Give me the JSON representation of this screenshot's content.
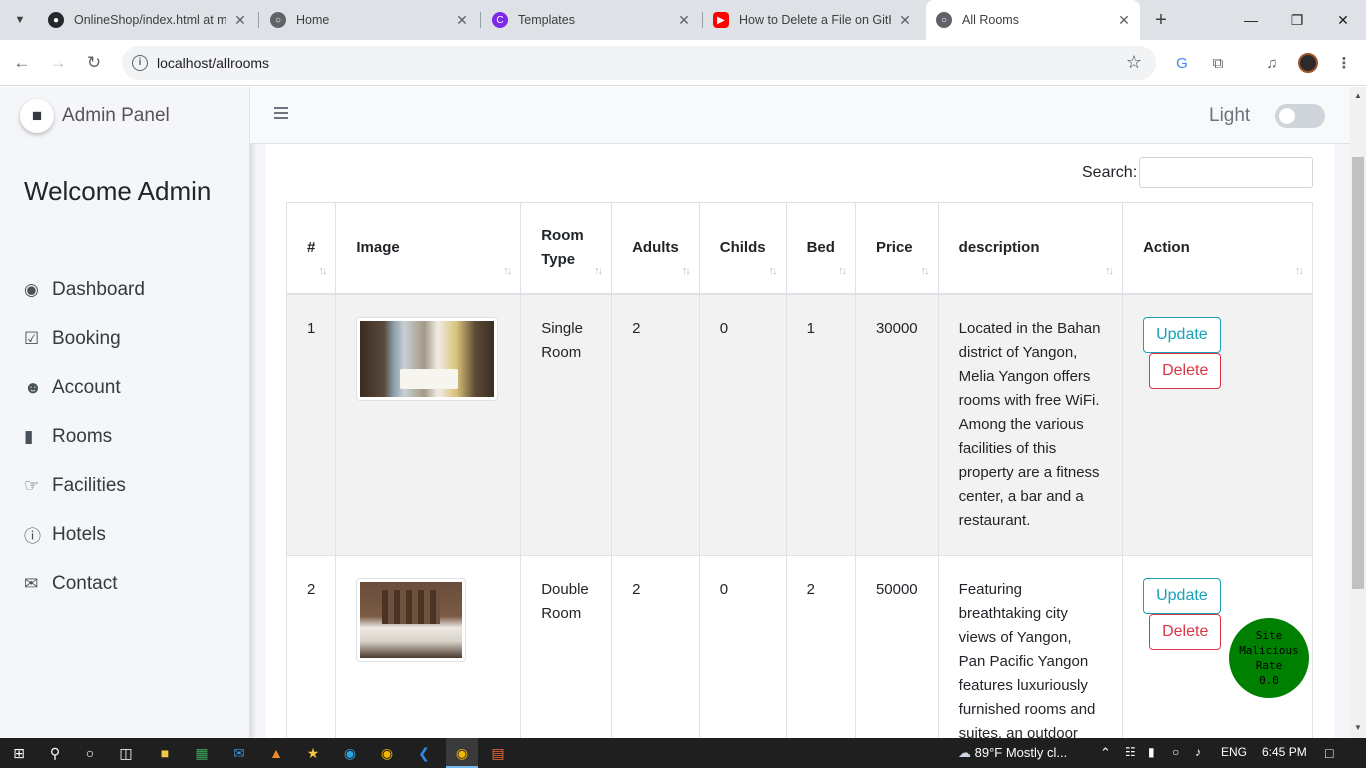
{
  "browser": {
    "tabs": [
      {
        "title": "OnlineShop/index.html at m",
        "icon": "github-icon"
      },
      {
        "title": "Home",
        "icon": "globe-icon"
      },
      {
        "title": "Templates",
        "icon": "canva-icon"
      },
      {
        "title": "How to Delete a File on GitH",
        "icon": "youtube-icon"
      },
      {
        "title": "All Rooms",
        "icon": "globe-icon",
        "active": true
      }
    ],
    "url": "localhost/allrooms"
  },
  "sidebar": {
    "brand": "Admin Panel",
    "welcome": "Welcome Admin",
    "items": [
      {
        "label": "Dashboard",
        "icon": "palette-icon"
      },
      {
        "label": "Booking",
        "icon": "calendar-check-icon"
      },
      {
        "label": "Account",
        "icon": "users-icon"
      },
      {
        "label": "Rooms",
        "icon": "door-icon"
      },
      {
        "label": "Facilities",
        "icon": "hand-holding-icon"
      },
      {
        "label": "Hotels",
        "icon": "info-icon"
      },
      {
        "label": "Contact",
        "icon": "envelope-icon"
      }
    ]
  },
  "topbar": {
    "theme_label": "Light",
    "theme_dark_enabled": false
  },
  "content": {
    "search_label": "Search:",
    "search_value": "",
    "columns": [
      "#",
      "Image",
      "Room Type",
      "Adults",
      "Childs",
      "Bed",
      "Price",
      "description",
      "Action"
    ],
    "rows": [
      {
        "num": "1",
        "room_type": "Single Room",
        "adults": "2",
        "childs": "0",
        "bed": "1",
        "price": "30000",
        "description": "Located in the Bahan district of Yangon, Melia Yangon offers rooms with free WiFi. Among the various facilities of this property are a fitness center, a bar and a restaurant.",
        "update": "Update",
        "delete": "Delete"
      },
      {
        "num": "2",
        "room_type": "Double Room",
        "adults": "2",
        "childs": "0",
        "bed": "2",
        "price": "50000",
        "description": "Featuring breathtaking city views of Yangon, Pan Pacific Yangon features luxuriously furnished rooms and suites, an outdoor",
        "update": "Update",
        "delete": "Delete"
      }
    ]
  },
  "overlay_badge": {
    "line1": "Site",
    "line2": "Malicious",
    "line3": "Rate",
    "line4": "0.0"
  },
  "taskbar": {
    "weather": "89°F  Mostly cl...",
    "language": "ENG",
    "time": "6:45 PM"
  }
}
